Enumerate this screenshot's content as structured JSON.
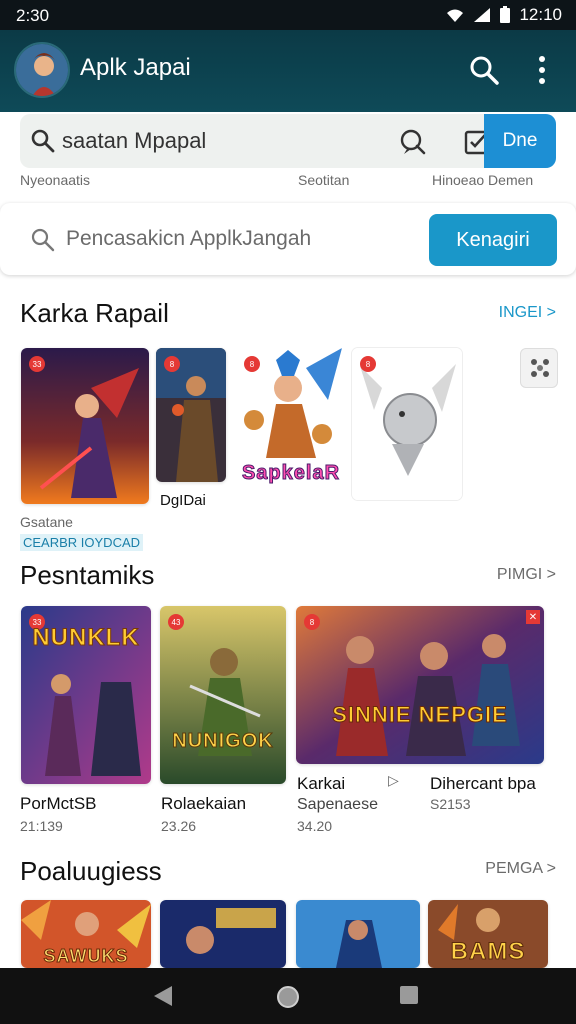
{
  "status": {
    "time": "2:30",
    "clock": "12:10"
  },
  "header": {
    "title": "Aplk Japai"
  },
  "search": {
    "query": "saatan Mpapal",
    "done_label": "Dne"
  },
  "sublabels": [
    "Nyeonaatis",
    "Seotitan",
    "Hinoeao Demen"
  ],
  "search2": {
    "placeholder": "Pencasakicn ApplkJangah",
    "button": "Kenagiri"
  },
  "sections": [
    {
      "title": "Karka Rapail",
      "link": "INGEI >",
      "items": [
        {
          "label": "Gsatane",
          "chip": "CEARBR IOYDCAD"
        },
        {
          "label": "DgIDai"
        },
        {
          "art_text": "SapkelaR"
        },
        {
          "label": ""
        }
      ]
    },
    {
      "title": "Pesntamiks",
      "link": "PIMGI >",
      "items": [
        {
          "art_text": "NUNKLK",
          "label": "PorMctSB",
          "sub": "21:139"
        },
        {
          "art_text": "NUNIGOK",
          "label": "Rolaekaian",
          "sub": "23.26"
        },
        {
          "art_text": "SINNIE NEPGIE",
          "label": "Karkai",
          "sub": "Sapenaese",
          "sub2": "34.20"
        },
        {
          "label": "Dihercant bpa",
          "sub": "S2153"
        }
      ]
    },
    {
      "title": "Poaluugiess",
      "link": "PEMGA >",
      "items": [
        {
          "art_text": "SAWUKS"
        },
        {
          "art_text": ""
        },
        {
          "art_text": ""
        },
        {
          "art_text": "BAMS"
        }
      ]
    }
  ],
  "colors": {
    "appbar": "#0e4a58",
    "accent": "#1a97c9",
    "done": "#1d8fd4"
  }
}
